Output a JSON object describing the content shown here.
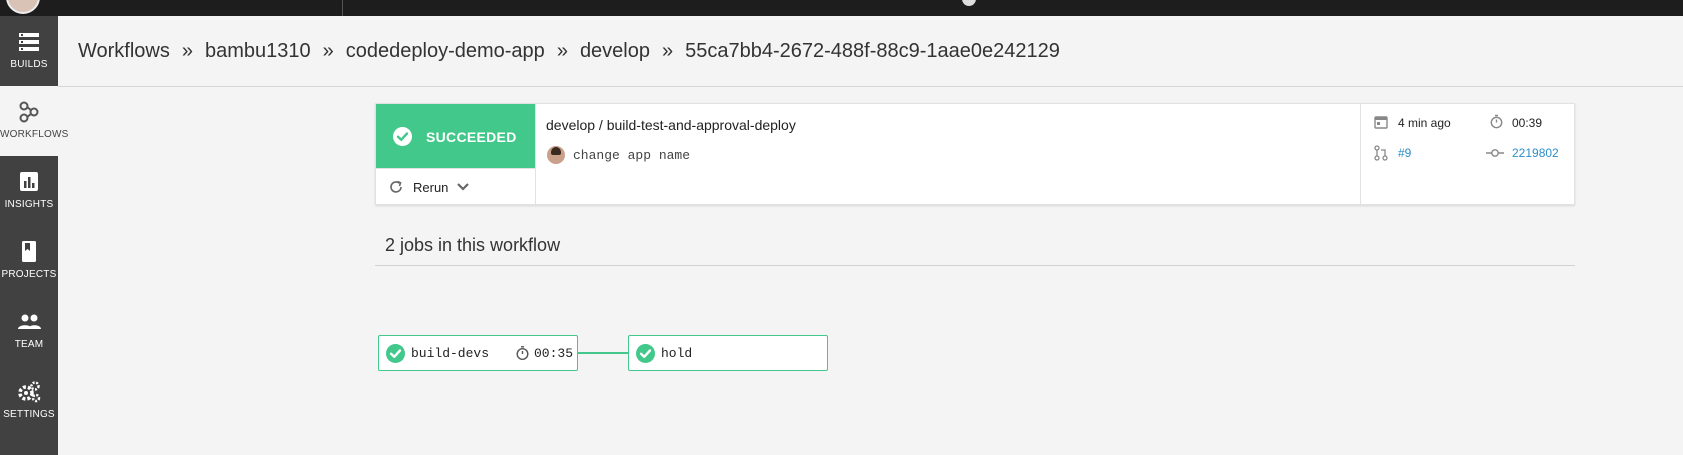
{
  "sidebar": {
    "items": [
      {
        "label": "BUILDS",
        "icon": "builds-icon"
      },
      {
        "label": "WORKFLOWS",
        "icon": "workflows-icon",
        "active": true
      },
      {
        "label": "INSIGHTS",
        "icon": "insights-icon"
      },
      {
        "label": "PROJECTS",
        "icon": "projects-icon"
      },
      {
        "label": "TEAM",
        "icon": "team-icon"
      },
      {
        "label": "SETTINGS",
        "icon": "settings-icon"
      }
    ]
  },
  "breadcrumb": {
    "items": [
      "Workflows",
      "bambu1310",
      "codedeploy-demo-app",
      "develop",
      "55ca7bb4-2672-488f-88c9-1aae0e242129"
    ],
    "separator": "»"
  },
  "workflow": {
    "status": "SUCCEEDED",
    "rerun_label": "Rerun",
    "title": "develop / build-test-and-approval-deploy",
    "commit_message": "change app name",
    "time_ago": "4 min ago",
    "duration": "00:39",
    "pr": "#9",
    "commit": "2219802"
  },
  "jobs": {
    "title": "2 jobs in this workflow",
    "items": [
      {
        "name": "build-devs",
        "duration": "00:35",
        "status": "success"
      },
      {
        "name": "hold",
        "duration": "",
        "status": "success"
      }
    ]
  },
  "colors": {
    "success": "#42c88a",
    "sidebar_bg": "#414141",
    "topbar_bg": "#1d1d1d",
    "link": "#2b8fc8"
  }
}
